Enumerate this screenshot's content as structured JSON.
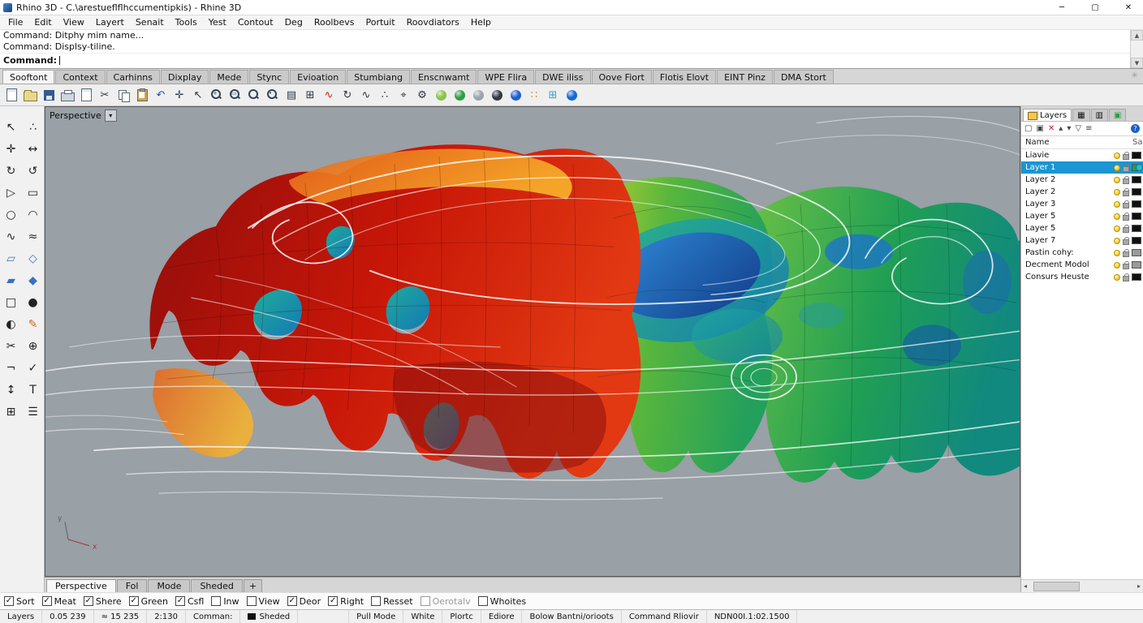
{
  "window": {
    "title": "Rhino 3D - C.\\arestueflflhccumentipkis) - Rhine 3D",
    "controls": {
      "minimize": "─",
      "maximize": "▢",
      "close": "✕"
    }
  },
  "menu": {
    "items": [
      "File",
      "Edit",
      "View",
      "Layert",
      "Senait",
      "Tools",
      "Yest",
      "Contout",
      "Deg",
      "Roolbevs",
      "Portuit",
      "Roovdiators",
      "Help"
    ]
  },
  "command": {
    "history": [
      "Command: Ditphy mim name...",
      "Command: Displsy-tiline."
    ],
    "prompt_label": "Command:"
  },
  "scroll": {
    "up": "▲",
    "down": "▼",
    "left": "◂",
    "right": "▸"
  },
  "ribbon": {
    "tabs": [
      "Sooftont",
      "Context",
      "Carhinns",
      "Dixplay",
      "Mede",
      "Stync",
      "Evioation",
      "Stumbiang",
      "Enscnwamt",
      "WPE Flira",
      "DWE iliss",
      "Oove Fiort",
      "Flotis Elovt",
      "EINT Pinz",
      "DMA Stort"
    ],
    "active": "Sooftont",
    "corner_glyph": "✳"
  },
  "toolbar": {
    "icons": [
      {
        "name": "new-file-icon",
        "kind": "doc"
      },
      {
        "name": "open-file-icon",
        "kind": "folder"
      },
      {
        "name": "save-icon",
        "kind": "floppy"
      },
      {
        "name": "print-icon",
        "kind": "printer"
      },
      {
        "name": "export-doc-icon",
        "kind": "doc"
      },
      {
        "name": "cut-icon",
        "kind": "glyph",
        "glyph": "✂"
      },
      {
        "name": "copy-icon",
        "kind": "copy"
      },
      {
        "name": "paste-icon",
        "kind": "clip"
      },
      {
        "name": "undo-icon",
        "kind": "glyph",
        "glyph": "↶",
        "color": "#2b4fa0"
      },
      {
        "name": "pan-icon",
        "kind": "glyph",
        "glyph": "✛"
      },
      {
        "name": "select-arrow-icon",
        "kind": "glyph",
        "glyph": "↖"
      },
      {
        "name": "zoom-in-icon",
        "kind": "zoom",
        "mark": "+"
      },
      {
        "name": "zoom-window-icon",
        "kind": "zoom",
        "mark": "▭"
      },
      {
        "name": "zoom-extents-icon",
        "kind": "zoom",
        "mark": ""
      },
      {
        "name": "zoom-selected-icon",
        "kind": "zoom",
        "mark": "•"
      },
      {
        "name": "sheet-icon",
        "kind": "glyph",
        "glyph": "▤"
      },
      {
        "name": "grid-table-icon",
        "kind": "glyph",
        "glyph": "⊞"
      },
      {
        "name": "delete-wave-icon",
        "kind": "glyph",
        "glyph": "∿",
        "color": "#cc2211"
      },
      {
        "name": "rotate-view-icon",
        "kind": "glyph",
        "glyph": "↻"
      },
      {
        "name": "curve-tool-icon",
        "kind": "glyph",
        "glyph": "∿"
      },
      {
        "name": "points-icon",
        "kind": "glyph",
        "glyph": "∴"
      },
      {
        "name": "gumball-icon",
        "kind": "glyph",
        "glyph": "⌖"
      },
      {
        "name": "settings-gear-icon",
        "kind": "glyph",
        "glyph": "⚙"
      },
      {
        "name": "material-drop-icon",
        "kind": "sphere",
        "color": "#8bc34a"
      },
      {
        "name": "render-sphere-green-icon",
        "kind": "sphere",
        "color": "#2e9e44"
      },
      {
        "name": "render-sphere-gray-icon",
        "kind": "sphere",
        "color": "#9aa4ab"
      },
      {
        "name": "render-sphere-dark-icon",
        "kind": "sphere",
        "color": "#333a40"
      },
      {
        "name": "render-sphere-blue-icon",
        "kind": "sphere",
        "color": "#1f5fd0"
      },
      {
        "name": "texture-speckle-icon",
        "kind": "glyph",
        "glyph": "∷",
        "color": "#c98a2a"
      },
      {
        "name": "hatch-grid-icon",
        "kind": "glyph",
        "glyph": "⊞",
        "color": "#3aa0c8"
      },
      {
        "name": "earth-globe-icon",
        "kind": "sphere",
        "color": "#1668d8"
      }
    ]
  },
  "left_toolbar": {
    "icons": [
      {
        "name": "select-tool-icon",
        "glyph": "↖"
      },
      {
        "name": "point-select-icon",
        "glyph": "∴"
      },
      {
        "name": "move-tool-icon",
        "glyph": "✛"
      },
      {
        "name": "stretch-tool-icon",
        "glyph": "↔"
      },
      {
        "name": "rotate-tool-icon",
        "glyph": "↻"
      },
      {
        "name": "rotate-ccw-icon",
        "glyph": "↺"
      },
      {
        "name": "polyline-tool-icon",
        "glyph": "▷"
      },
      {
        "name": "rectangle-tool-icon",
        "glyph": "▭"
      },
      {
        "name": "circle-tool-icon",
        "glyph": "○"
      },
      {
        "name": "arc-tool-icon",
        "glyph": "◠"
      },
      {
        "name": "curve-tool-icon",
        "glyph": "∿"
      },
      {
        "name": "freeform-tool-icon",
        "glyph": "≈"
      },
      {
        "name": "surface-tool-icon",
        "glyph": "▱",
        "color": "#3a6fc4"
      },
      {
        "name": "patch-tool-icon",
        "glyph": "◇",
        "color": "#3a6fc4"
      },
      {
        "name": "plane-tool-icon",
        "glyph": "▰",
        "color": "#3a6fc4"
      },
      {
        "name": "solid-tool-icon",
        "glyph": "◆",
        "color": "#3a6fc4"
      },
      {
        "name": "box-tool-icon",
        "glyph": "□"
      },
      {
        "name": "sphere-tool-icon",
        "glyph": "●"
      },
      {
        "name": "boolean-tool-icon",
        "glyph": "◐"
      },
      {
        "name": "annotate-pencil-icon",
        "glyph": "✎",
        "color": "#d2691e"
      },
      {
        "name": "trim-tool-icon",
        "glyph": "✂"
      },
      {
        "name": "join-tool-icon",
        "glyph": "⊕"
      },
      {
        "name": "offset-tool-icon",
        "glyph": "¬"
      },
      {
        "name": "check-tool-icon",
        "glyph": "✓"
      },
      {
        "name": "vertical-tool-icon",
        "glyph": "↕"
      },
      {
        "name": "text-tool-icon",
        "glyph": "T"
      },
      {
        "name": "grid-tool-icon",
        "glyph": "⊞"
      },
      {
        "name": "list-tool-icon",
        "glyph": "☰"
      }
    ]
  },
  "viewport": {
    "label": "Perspective",
    "dropdown_glyph": "▾",
    "axis_x": "x",
    "axis_y": "y"
  },
  "layers_panel": {
    "panel_tabs": [
      {
        "name": "tab-layers",
        "label": "Layers",
        "active": true
      },
      {
        "name": "tab-display",
        "icon": "▦"
      },
      {
        "name": "tab-notes",
        "icon": "▥"
      },
      {
        "name": "tab-materials",
        "icon": "▣",
        "color": "#2e9e44"
      }
    ],
    "tools": [
      {
        "name": "new-layer-icon",
        "glyph": "▢"
      },
      {
        "name": "new-sublayer-icon",
        "glyph": "▣"
      },
      {
        "name": "delete-layer-icon",
        "glyph": "✕",
        "color": "#cc2222"
      },
      {
        "name": "move-up-icon",
        "glyph": "▴"
      },
      {
        "name": "move-down-icon",
        "glyph": "▾"
      },
      {
        "name": "filter-icon",
        "glyph": "▽"
      },
      {
        "name": "columns-icon",
        "glyph": "≡"
      },
      {
        "name": "help-icon",
        "glyph": "?",
        "badge": "#1a62c8"
      }
    ],
    "columns": {
      "name": "Name",
      "trail": "Sa"
    },
    "rows": [
      {
        "name": "Liavie",
        "swatch": "#101010",
        "selected": false
      },
      {
        "name": "Layer 1",
        "swatch": "#15a15c",
        "selected": true
      },
      {
        "name": "Layer 2",
        "swatch": "#101010",
        "selected": false
      },
      {
        "name": "Layer 2",
        "swatch": "#101010",
        "selected": false
      },
      {
        "name": "Layer 3",
        "swatch": "#101010",
        "selected": false
      },
      {
        "name": "Layer 5",
        "swatch": "#101010",
        "selected": false
      },
      {
        "name": "Layer 5",
        "swatch": "#101010",
        "selected": false
      },
      {
        "name": "Layer 7",
        "swatch": "#101010",
        "selected": false
      },
      {
        "name": "Pastin cohy:",
        "swatch": "#9a9a9a",
        "selected": false
      },
      {
        "name": "Decment Modol",
        "swatch": "#9a9a9a",
        "selected": false
      },
      {
        "name": "Consurs Heuste",
        "swatch": "#101010",
        "selected": false
      }
    ]
  },
  "viewport_tabs": {
    "tabs": [
      "Perspective",
      "Fol",
      "Mode",
      "Sheded"
    ],
    "active": "Perspective",
    "add": "+"
  },
  "checkbox_row": {
    "items": [
      {
        "label": "Sort",
        "checked": true
      },
      {
        "label": "Meat",
        "checked": true
      },
      {
        "label": "Shere",
        "checked": true
      },
      {
        "label": "Green",
        "checked": true
      },
      {
        "label": "Csfl",
        "checked": true
      },
      {
        "label": "Inw",
        "checked": false
      },
      {
        "label": "View",
        "checked": false
      },
      {
        "label": "Deor",
        "checked": true
      },
      {
        "label": "Right",
        "checked": true
      },
      {
        "label": "Resset",
        "checked": false
      },
      {
        "label": "Oerotalv",
        "checked": false,
        "disabled": true
      },
      {
        "label": "Whoites",
        "checked": false
      }
    ]
  },
  "status_bar": {
    "cells": [
      {
        "label": "Layers"
      },
      {
        "label": "0.05 239"
      },
      {
        "label": "≈ 15 235"
      },
      {
        "label": "2:130"
      },
      {
        "label": "Comman:"
      },
      {
        "label": "Sheded",
        "swatch": "#101010"
      },
      {
        "label": "",
        "spacer": true
      },
      {
        "label": "Pull Mode"
      },
      {
        "label": "White"
      },
      {
        "label": "Plortc"
      },
      {
        "label": "Ediore"
      },
      {
        "label": "Bolow Bantni/orioots"
      },
      {
        "label": "Command Rliovir"
      },
      {
        "label": "NDN00I.1:02.1500"
      }
    ]
  }
}
